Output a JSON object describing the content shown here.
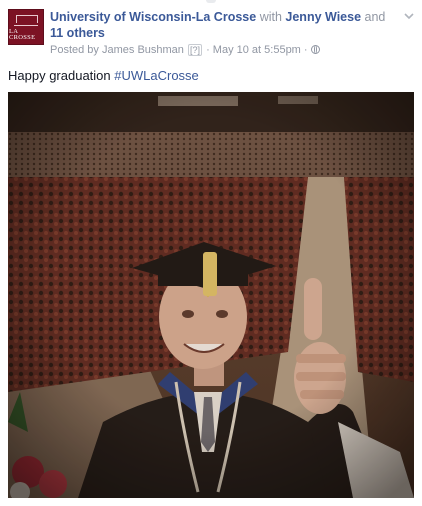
{
  "post": {
    "page_name": "University of Wisconsin-La Crosse",
    "with_text": "with",
    "tagged_person": "Jenny Wiese",
    "and_text": "and",
    "others_link": "11 others",
    "posted_by_prefix": "Posted by",
    "posted_by_name": "James Bushman",
    "help_marker": "[?]",
    "separator": "·",
    "timestamp": "May 10 at 5:55pm",
    "privacy_icon": "globe-icon",
    "options_icon": "chevron-down-icon",
    "message_text": "Happy graduation ",
    "hashtag": "#UWLaCrosse",
    "avatar_text": "LA CROSSE",
    "photo_alt": ""
  },
  "colors": {
    "link": "#3b5998",
    "muted": "#9197a3",
    "brand": "#7c1224"
  }
}
